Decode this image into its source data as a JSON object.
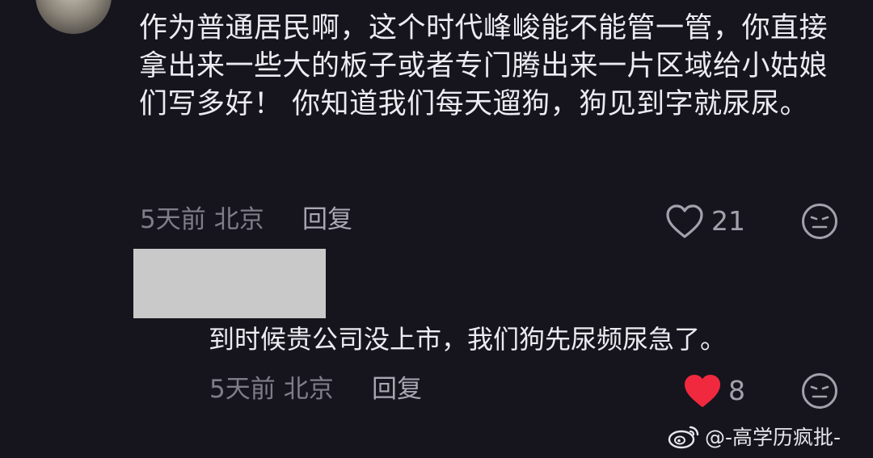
{
  "comment": {
    "text": "作为普通居民啊，这个时代峰峻能不能管一管，你直接拿出来一些大的板子或者专门腾出来一片区域给小姑娘们写多好！ 你知道我们每天遛狗，狗见到字就尿尿。",
    "time": "5天前",
    "location": "北京",
    "reply_label": "回复",
    "likes": "21",
    "liked": false
  },
  "reply": {
    "text": "到时候贵公司没上市，我们狗先尿频尿急了。",
    "time": "5天前",
    "location": "北京",
    "reply_label": "回复",
    "likes": "8",
    "liked": true
  },
  "watermark": {
    "text": "@-高学历疯批-"
  },
  "colors": {
    "background": "#16151d",
    "liked_heart": "#f0293f",
    "meta_text": "#7f7d88"
  },
  "icons": {
    "like": "heart-icon",
    "dislike": "neutral-face-icon",
    "brand": "weibo-logo-icon"
  }
}
